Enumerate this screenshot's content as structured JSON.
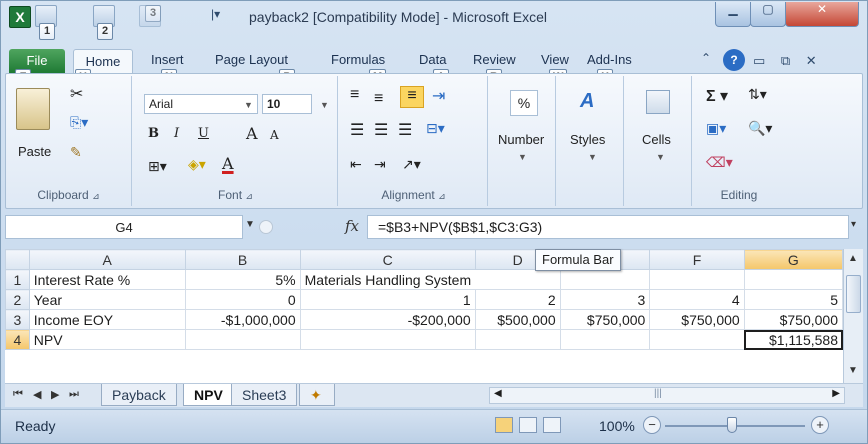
{
  "window": {
    "title": "payback2  [Compatibility Mode]  -  Microsoft Excel",
    "app_icon": "X",
    "qat_keytips": [
      "1",
      "2",
      "3"
    ]
  },
  "ribbon_tabs": [
    {
      "label": "File",
      "keytip": "F"
    },
    {
      "label": "Home",
      "keytip": "H"
    },
    {
      "label": "Insert",
      "keytip": "N"
    },
    {
      "label": "Page Layout",
      "keytip": "P"
    },
    {
      "label": "Formulas",
      "keytip": "M"
    },
    {
      "label": "Data",
      "keytip": "A"
    },
    {
      "label": "Review",
      "keytip": "R"
    },
    {
      "label": "View",
      "keytip": "W"
    },
    {
      "label": "Add-Ins",
      "keytip": "X"
    }
  ],
  "ribbon": {
    "clipboard": {
      "label": "Clipboard",
      "paste_label": "Paste"
    },
    "font": {
      "label": "Font",
      "font_name": "Arial",
      "font_size": "10",
      "bold": "B",
      "italic": "I",
      "underline": "U",
      "grow": "A",
      "shrink": "A"
    },
    "alignment": {
      "label": "Alignment"
    },
    "number": {
      "label": "Number",
      "percent": "%"
    },
    "styles": {
      "label": "Styles"
    },
    "cells": {
      "label": "Cells"
    },
    "editing": {
      "label": "Editing",
      "sigma": "Σ"
    }
  },
  "formula_bar": {
    "name_box": "G4",
    "fx": "fx",
    "formula": "=$B3+NPV($B$1,$C3:G3)",
    "tooltip": "Formula Bar"
  },
  "grid": {
    "columns": [
      "A",
      "B",
      "C",
      "D",
      "E",
      "F",
      "G"
    ],
    "selected_column": "G",
    "selected_row": "4",
    "rows": [
      {
        "num": "1",
        "cells": [
          "Interest Rate %",
          "5%",
          "Materials Handling System",
          "",
          "",
          "",
          ""
        ]
      },
      {
        "num": "2",
        "cells": [
          "Year",
          "0",
          "1",
          "2",
          "3",
          "4",
          "5"
        ]
      },
      {
        "num": "3",
        "cells": [
          "Income EOY",
          "-$1,000,000",
          "-$200,000",
          "$500,000",
          "$750,000",
          "$750,000",
          "$750,000"
        ]
      },
      {
        "num": "4",
        "cells": [
          "NPV",
          "",
          "",
          "",
          "",
          "",
          "$1,115,588"
        ]
      }
    ]
  },
  "sheets": {
    "tabs": [
      "Payback",
      "NPV",
      "Sheet3"
    ],
    "active": "NPV"
  },
  "status": {
    "text": "Ready",
    "zoom": "100%",
    "zoom_level": 1.0
  }
}
